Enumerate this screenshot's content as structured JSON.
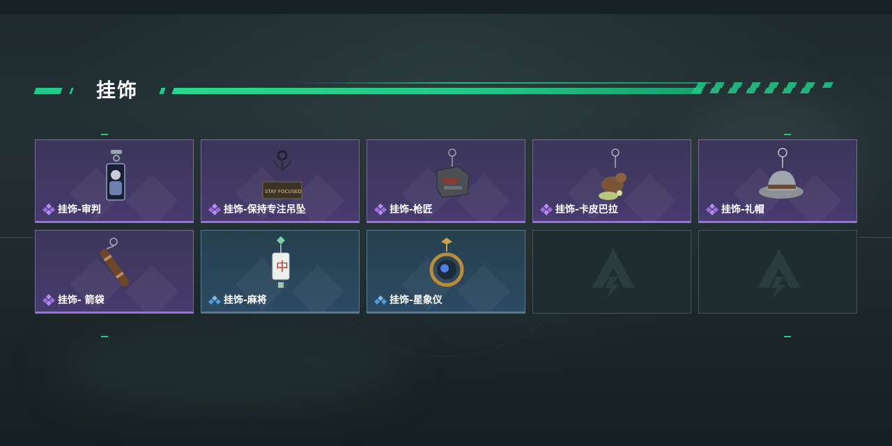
{
  "section": {
    "title": "挂饰",
    "accent_color": "#23c98a"
  },
  "items": [
    {
      "label": "挂饰-审判",
      "rarity": "purple",
      "icon": "judge-card-charm-icon"
    },
    {
      "label": "挂饰-保持专注吊坠",
      "rarity": "purple",
      "icon": "stay-focused-tag-charm-icon"
    },
    {
      "label": "挂饰-枪匠",
      "rarity": "purple",
      "icon": "gunsmith-charm-icon"
    },
    {
      "label": "挂饰-卡皮巴拉",
      "rarity": "purple",
      "icon": "capybara-charm-icon"
    },
    {
      "label": "挂饰-礼帽",
      "rarity": "purple",
      "icon": "fedora-hat-charm-icon"
    },
    {
      "label": "挂饰- 箭袋",
      "rarity": "purple",
      "icon": "quiver-charm-icon"
    },
    {
      "label": "挂饰-麻将",
      "rarity": "blue",
      "icon": "mahjong-tile-charm-icon"
    },
    {
      "label": "挂饰-星象仪",
      "rarity": "blue",
      "icon": "astrolabe-charm-icon"
    },
    {
      "label": "",
      "rarity": "empty",
      "icon": "empty-slot-logo-icon"
    },
    {
      "label": "",
      "rarity": "empty",
      "icon": "empty-slot-logo-icon"
    }
  ],
  "colors": {
    "purple_rarity": "#a06ee0",
    "blue_rarity": "#4f9fe0"
  }
}
